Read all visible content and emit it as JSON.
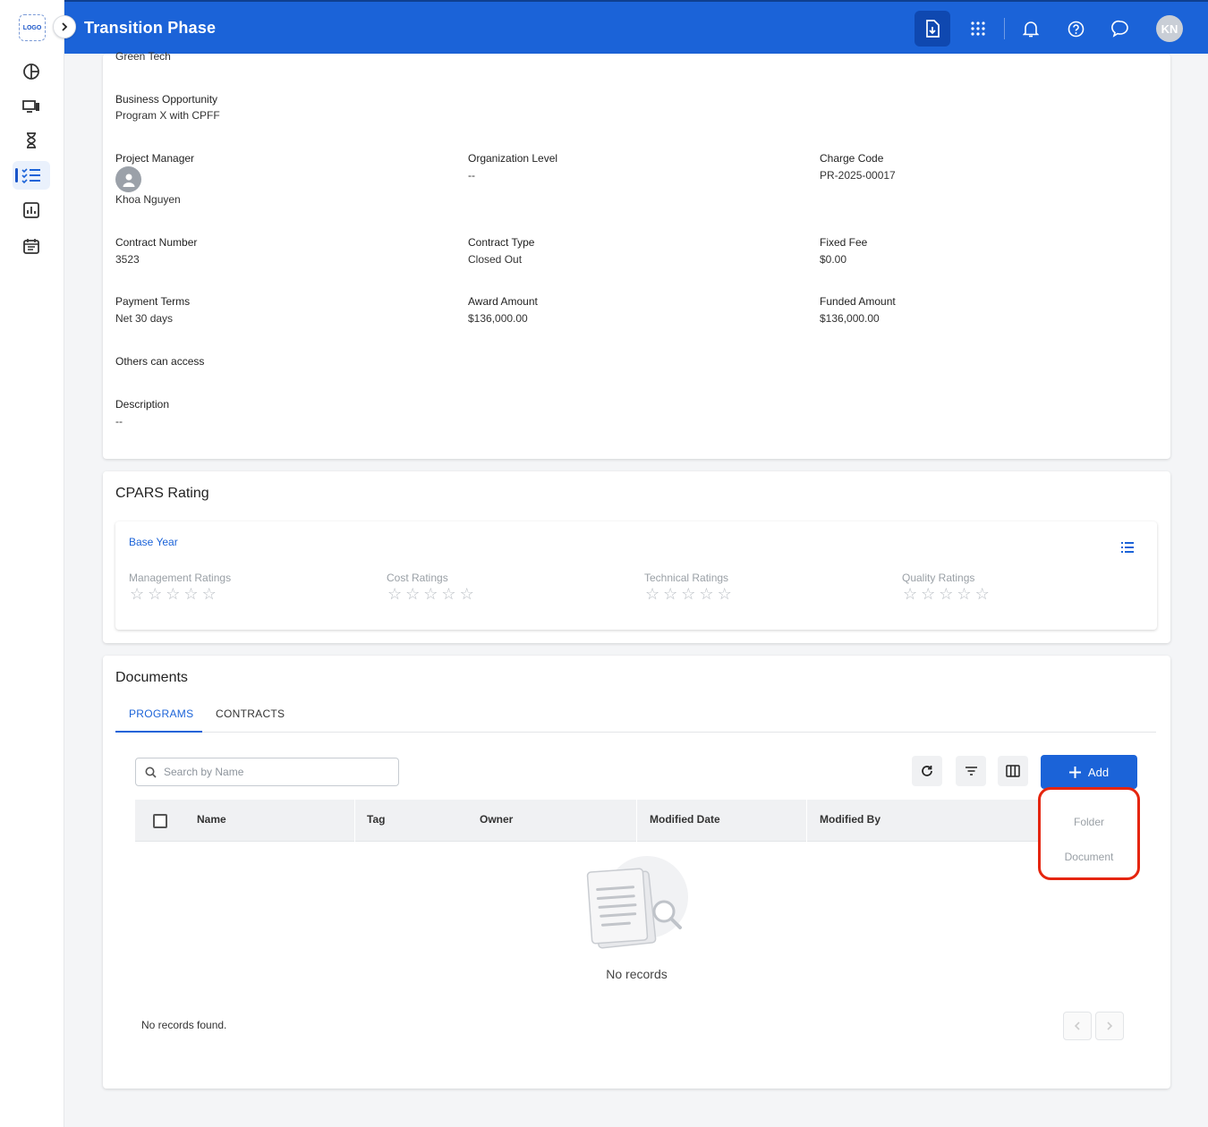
{
  "sidebar": {
    "logo_text": "LOGO",
    "items": [
      {
        "name": "dashboard-icon"
      },
      {
        "name": "devices-icon"
      },
      {
        "name": "hourglass-icon"
      },
      {
        "name": "checklist-icon",
        "active": true
      },
      {
        "name": "reports-icon"
      },
      {
        "name": "calendar-icon"
      }
    ]
  },
  "header": {
    "title": "Transition Phase",
    "avatar_initials": "KN",
    "icons": [
      "document-download-icon",
      "apps-grid-icon",
      "bell-icon",
      "help-icon",
      "chat-icon"
    ]
  },
  "details": {
    "top_value": "Green Tech",
    "business_opportunity": {
      "label": "Business Opportunity",
      "value": "Program X with CPFF"
    },
    "project_manager": {
      "label": "Project Manager",
      "value": "Khoa Nguyen"
    },
    "organization_level": {
      "label": "Organization Level",
      "value": "--"
    },
    "charge_code": {
      "label": "Charge Code",
      "value": "PR-2025-00017"
    },
    "contract_number": {
      "label": "Contract Number",
      "value": "3523"
    },
    "contract_type": {
      "label": "Contract Type",
      "value": "Closed Out"
    },
    "fixed_fee": {
      "label": "Fixed Fee",
      "value": "$0.00"
    },
    "payment_terms": {
      "label": "Payment Terms",
      "value": "Net 30 days"
    },
    "award_amount": {
      "label": "Award Amount",
      "value": "$136,000.00"
    },
    "funded_amount": {
      "label": "Funded Amount",
      "value": "$136,000.00"
    },
    "others_can_access": {
      "label": "Others can access"
    },
    "description": {
      "label": "Description",
      "value": "--"
    }
  },
  "cpars": {
    "title": "CPARS Rating",
    "period": "Base Year",
    "ratings": [
      {
        "label": "Management Ratings",
        "stars": 0,
        "max": 5
      },
      {
        "label": "Cost Ratings",
        "stars": 0,
        "max": 5
      },
      {
        "label": "Technical Ratings",
        "stars": 0,
        "max": 5
      },
      {
        "label": "Quality Ratings",
        "stars": 0,
        "max": 5
      }
    ]
  },
  "documents": {
    "title": "Documents",
    "tabs": [
      {
        "label": "PROGRAMS",
        "active": true
      },
      {
        "label": "CONTRACTS"
      }
    ],
    "search_placeholder": "Search by Name",
    "add_label": "Add",
    "columns": [
      "Name",
      "Tag",
      "Owner",
      "Modified Date",
      "Modified By"
    ],
    "empty_text": "No records",
    "records_found": "No records found.",
    "add_menu": [
      "Folder",
      "Document"
    ]
  },
  "colors": {
    "primary": "#1b63d8",
    "highlight": "#e5250e"
  }
}
